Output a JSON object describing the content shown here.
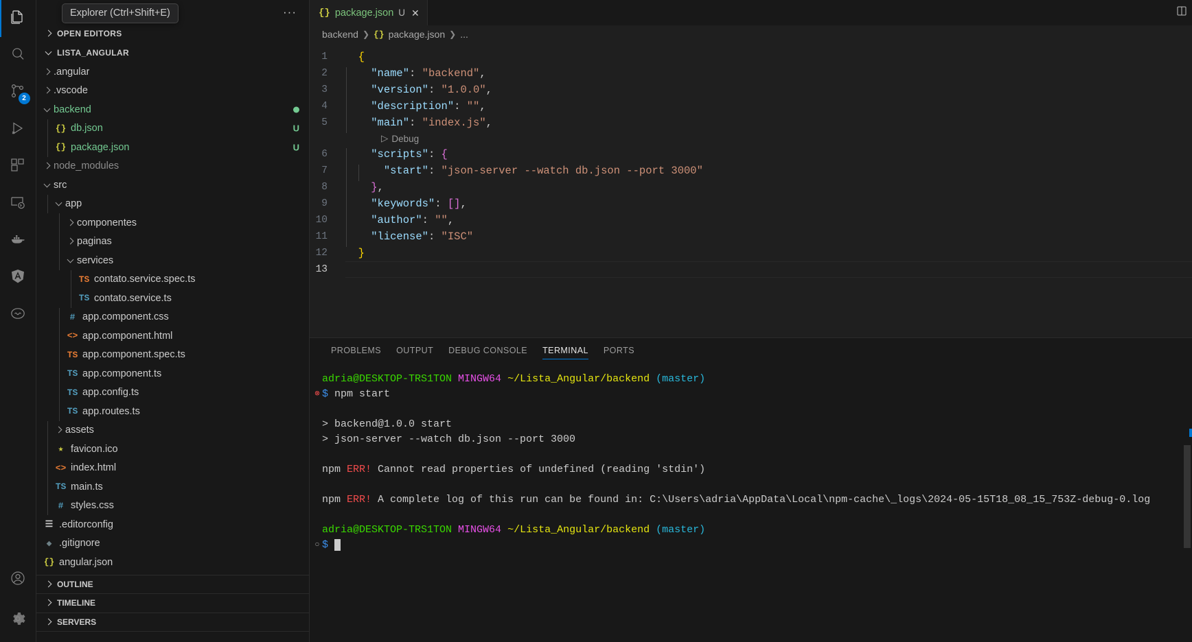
{
  "activitybar": {
    "items": [
      {
        "name": "explorer",
        "icon": "files-icon",
        "active": true,
        "badge": null
      },
      {
        "name": "search",
        "icon": "search-icon",
        "active": false,
        "badge": null
      },
      {
        "name": "source-control",
        "icon": "source-control-icon",
        "active": false,
        "badge": "2"
      },
      {
        "name": "run-and-debug",
        "icon": "run-debug-icon",
        "active": false,
        "badge": null
      },
      {
        "name": "extensions",
        "icon": "extensions-icon",
        "active": false,
        "badge": null
      },
      {
        "name": "remote-explorer",
        "icon": "remote-console-icon",
        "active": false,
        "badge": null
      },
      {
        "name": "docker",
        "icon": "docker-whale-icon",
        "active": false,
        "badge": null
      },
      {
        "name": "angular",
        "icon": "angular-shield-icon",
        "active": false,
        "badge": null
      },
      {
        "name": "thunder-client",
        "icon": "thunder-circle-icon",
        "active": false,
        "badge": null
      }
    ],
    "bottom": [
      {
        "name": "accounts",
        "icon": "account-person-icon"
      },
      {
        "name": "manage",
        "icon": "gear-icon"
      }
    ]
  },
  "sidebar": {
    "tooltip": "Explorer (Ctrl+Shift+E)",
    "more_actions": "···",
    "open_editors": "OPEN EDITORS",
    "workspace": "LISTA_ANGULAR",
    "tree": [
      {
        "label": ".angular",
        "type": "folder",
        "indent": 1,
        "open": false,
        "icon": "",
        "icon_color": ""
      },
      {
        "label": ".vscode",
        "type": "folder",
        "indent": 1,
        "open": false,
        "icon": "",
        "icon_color": ""
      },
      {
        "label": "backend",
        "type": "folder",
        "indent": 1,
        "open": true,
        "icon": "",
        "icon_color": "",
        "text_color": "#73c991",
        "dot": "#73c991"
      },
      {
        "label": "db.json",
        "type": "file",
        "indent": 2,
        "icon": "{}",
        "icon_color": "#cbcb41",
        "text_color": "#73c991",
        "badge": "U",
        "badge_color": "#73c991"
      },
      {
        "label": "package.json",
        "type": "file",
        "indent": 2,
        "icon": "{}",
        "icon_color": "#cbcb41",
        "text_color": "#73c991",
        "badge": "U",
        "badge_color": "#73c991"
      },
      {
        "label": "node_modules",
        "type": "folder",
        "indent": 1,
        "open": false,
        "text_color": "#8c8c8c"
      },
      {
        "label": "src",
        "type": "folder",
        "indent": 1,
        "open": true
      },
      {
        "label": "app",
        "type": "folder",
        "indent": 2,
        "open": true
      },
      {
        "label": "componentes",
        "type": "folder",
        "indent": 3,
        "open": false
      },
      {
        "label": "paginas",
        "type": "folder",
        "indent": 3,
        "open": false
      },
      {
        "label": "services",
        "type": "folder",
        "indent": 3,
        "open": true
      },
      {
        "label": "contato.service.spec.ts",
        "type": "file",
        "indent": 4,
        "icon": "TS",
        "icon_color": "#e37933"
      },
      {
        "label": "contato.service.ts",
        "type": "file",
        "indent": 4,
        "icon": "TS",
        "icon_color": "#519aba"
      },
      {
        "label": "app.component.css",
        "type": "file",
        "indent": 3,
        "icon": "#",
        "icon_color": "#519aba"
      },
      {
        "label": "app.component.html",
        "type": "file",
        "indent": 3,
        "icon": "<>",
        "icon_color": "#e37933"
      },
      {
        "label": "app.component.spec.ts",
        "type": "file",
        "indent": 3,
        "icon": "TS",
        "icon_color": "#e37933"
      },
      {
        "label": "app.component.ts",
        "type": "file",
        "indent": 3,
        "icon": "TS",
        "icon_color": "#519aba"
      },
      {
        "label": "app.config.ts",
        "type": "file",
        "indent": 3,
        "icon": "TS",
        "icon_color": "#519aba"
      },
      {
        "label": "app.routes.ts",
        "type": "file",
        "indent": 3,
        "icon": "TS",
        "icon_color": "#519aba"
      },
      {
        "label": "assets",
        "type": "folder",
        "indent": 2,
        "open": false
      },
      {
        "label": "favicon.ico",
        "type": "file",
        "indent": 2,
        "icon": "★",
        "icon_color": "#cbcb41"
      },
      {
        "label": "index.html",
        "type": "file",
        "indent": 2,
        "icon": "<>",
        "icon_color": "#e37933"
      },
      {
        "label": "main.ts",
        "type": "file",
        "indent": 2,
        "icon": "TS",
        "icon_color": "#519aba"
      },
      {
        "label": "styles.css",
        "type": "file",
        "indent": 2,
        "icon": "#",
        "icon_color": "#519aba"
      },
      {
        "label": ".editorconfig",
        "type": "file",
        "indent": 1,
        "icon": "☰",
        "icon_color": "#cccccc"
      },
      {
        "label": ".gitignore",
        "type": "file",
        "indent": 1,
        "icon": "◆",
        "icon_color": "#6d8086"
      },
      {
        "label": "angular.json",
        "type": "file",
        "indent": 1,
        "icon": "{}",
        "icon_color": "#cbcb41"
      }
    ],
    "sections": [
      "OUTLINE",
      "TIMELINE",
      "SERVERS"
    ]
  },
  "editor": {
    "tab": {
      "icon": "json-icon",
      "name": "package.json",
      "dirty_badge": "U",
      "close": "✕"
    },
    "breadcrumb": {
      "root": "backend",
      "file": "package.json",
      "tail": "..."
    },
    "codelens": {
      "icon": "▷",
      "label": "Debug"
    },
    "lines": [
      {
        "no": "1",
        "indent": 0,
        "tokens": [
          {
            "t": "{",
            "c": "b1"
          }
        ]
      },
      {
        "no": "2",
        "indent": 1,
        "tokens": [
          {
            "t": "\"name\"",
            "c": "k"
          },
          {
            "t": ": ",
            "c": "p"
          },
          {
            "t": "\"backend\"",
            "c": "s"
          },
          {
            "t": ",",
            "c": "p"
          }
        ]
      },
      {
        "no": "3",
        "indent": 1,
        "tokens": [
          {
            "t": "\"version\"",
            "c": "k"
          },
          {
            "t": ": ",
            "c": "p"
          },
          {
            "t": "\"1.0.0\"",
            "c": "s"
          },
          {
            "t": ",",
            "c": "p"
          }
        ]
      },
      {
        "no": "4",
        "indent": 1,
        "tokens": [
          {
            "t": "\"description\"",
            "c": "k"
          },
          {
            "t": ": ",
            "c": "p"
          },
          {
            "t": "\"\"",
            "c": "s"
          },
          {
            "t": ",",
            "c": "p"
          }
        ]
      },
      {
        "no": "5",
        "indent": 1,
        "tokens": [
          {
            "t": "\"main\"",
            "c": "k"
          },
          {
            "t": ": ",
            "c": "p"
          },
          {
            "t": "\"index.js\"",
            "c": "s"
          },
          {
            "t": ",",
            "c": "p"
          }
        ]
      },
      {
        "no": "6",
        "indent": 1,
        "tokens": [
          {
            "t": "\"scripts\"",
            "c": "k"
          },
          {
            "t": ": ",
            "c": "p"
          },
          {
            "t": "{",
            "c": "b2"
          }
        ]
      },
      {
        "no": "7",
        "indent": 2,
        "tokens": [
          {
            "t": "\"start\"",
            "c": "k"
          },
          {
            "t": ": ",
            "c": "p"
          },
          {
            "t": "\"json-server --watch db.json --port 3000\"",
            "c": "s"
          }
        ]
      },
      {
        "no": "8",
        "indent": 1,
        "tokens": [
          {
            "t": "}",
            "c": "b2"
          },
          {
            "t": ",",
            "c": "p"
          }
        ]
      },
      {
        "no": "9",
        "indent": 1,
        "tokens": [
          {
            "t": "\"keywords\"",
            "c": "k"
          },
          {
            "t": ": ",
            "c": "p"
          },
          {
            "t": "[]",
            "c": "b2"
          },
          {
            "t": ",",
            "c": "p"
          }
        ]
      },
      {
        "no": "10",
        "indent": 1,
        "tokens": [
          {
            "t": "\"author\"",
            "c": "k"
          },
          {
            "t": ": ",
            "c": "p"
          },
          {
            "t": "\"\"",
            "c": "s"
          },
          {
            "t": ",",
            "c": "p"
          }
        ]
      },
      {
        "no": "11",
        "indent": 1,
        "tokens": [
          {
            "t": "\"license\"",
            "c": "k"
          },
          {
            "t": ": ",
            "c": "p"
          },
          {
            "t": "\"ISC\"",
            "c": "s"
          }
        ]
      },
      {
        "no": "12",
        "indent": 0,
        "tokens": [
          {
            "t": "}",
            "c": "b1"
          }
        ]
      },
      {
        "no": "13",
        "indent": 0,
        "tokens": [],
        "active": true
      }
    ]
  },
  "panel": {
    "tabs": [
      {
        "label": "PROBLEMS",
        "active": false
      },
      {
        "label": "OUTPUT",
        "active": false
      },
      {
        "label": "DEBUG CONSOLE",
        "active": false
      },
      {
        "label": "TERMINAL",
        "active": true
      },
      {
        "label": "PORTS",
        "active": false
      }
    ],
    "terminal": {
      "lines": [
        {
          "gutter": "",
          "gutter_color": "",
          "spans": [
            {
              "t": "adria@DESKTOP-TRS1TON",
              "c": "t-user"
            },
            {
              "t": " ",
              "c": "t-white"
            },
            {
              "t": "MINGW64",
              "c": "t-host"
            },
            {
              "t": " ",
              "c": "t-white"
            },
            {
              "t": "~/Lista_Angular/backend",
              "c": "t-path"
            },
            {
              "t": " ",
              "c": "t-white"
            },
            {
              "t": "(master)",
              "c": "t-branch"
            }
          ]
        },
        {
          "gutter": "⊗",
          "gutter_color": "#f14c4c",
          "spans": [
            {
              "t": "$",
              "c": "t-dollar"
            },
            {
              "t": " npm start",
              "c": "t-white"
            }
          ]
        },
        {
          "gutter": "",
          "gutter_color": "",
          "spans": []
        },
        {
          "gutter": "",
          "gutter_color": "",
          "spans": [
            {
              "t": "> backend@1.0.0 start",
              "c": "t-white"
            }
          ]
        },
        {
          "gutter": "",
          "gutter_color": "",
          "spans": [
            {
              "t": "> json-server --watch db.json --port 3000",
              "c": "t-white"
            }
          ]
        },
        {
          "gutter": "",
          "gutter_color": "",
          "spans": []
        },
        {
          "gutter": "",
          "gutter_color": "",
          "spans": [
            {
              "t": "npm ",
              "c": "t-white"
            },
            {
              "t": "ERR!",
              "c": "t-err"
            },
            {
              "t": " Cannot read properties of undefined (reading 'stdin')",
              "c": "t-white"
            }
          ]
        },
        {
          "gutter": "",
          "gutter_color": "",
          "spans": []
        },
        {
          "gutter": "",
          "gutter_color": "",
          "spans": [
            {
              "t": "npm ",
              "c": "t-white"
            },
            {
              "t": "ERR!",
              "c": "t-err"
            },
            {
              "t": " A complete log of this run can be found in: C:\\Users\\adria\\AppData\\Local\\npm-cache\\_logs\\2024-05-15T18_08_15_753Z-debug-0.log",
              "c": "t-white"
            }
          ]
        },
        {
          "gutter": "",
          "gutter_color": "",
          "spans": []
        },
        {
          "gutter": "",
          "gutter_color": "",
          "spans": [
            {
              "t": "adria@DESKTOP-TRS1TON",
              "c": "t-user"
            },
            {
              "t": " ",
              "c": "t-white"
            },
            {
              "t": "MINGW64",
              "c": "t-host"
            },
            {
              "t": " ",
              "c": "t-white"
            },
            {
              "t": "~/Lista_Angular/backend",
              "c": "t-path"
            },
            {
              "t": " ",
              "c": "t-white"
            },
            {
              "t": "(master)",
              "c": "t-branch"
            }
          ]
        },
        {
          "gutter": "○",
          "gutter_color": "#9d9d9d",
          "spans": [
            {
              "t": "$",
              "c": "t-dollar"
            },
            {
              "t": " ",
              "c": "t-white"
            }
          ],
          "cursor": true
        }
      ]
    }
  },
  "colors": {
    "accent": "#0078d4",
    "activity_bg": "#181818",
    "editor_bg": "#1f1f1f",
    "error": "#f14c4c",
    "git_untracked": "#73c991"
  }
}
